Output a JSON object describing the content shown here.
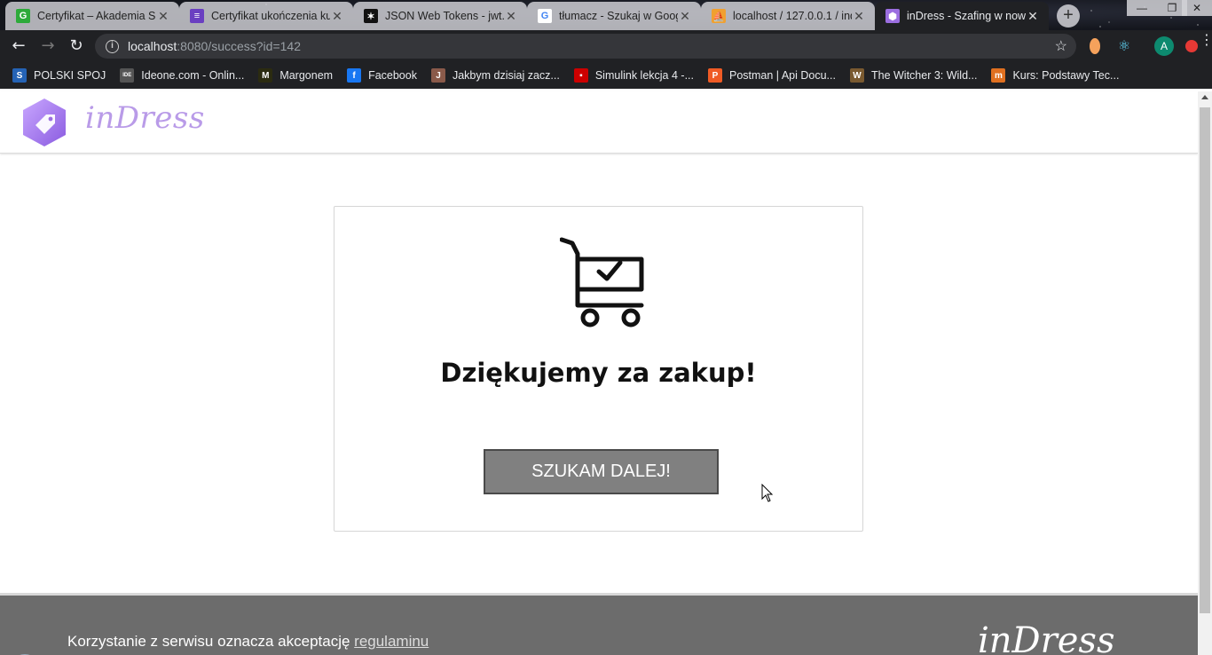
{
  "browser": {
    "tabs": [
      {
        "title": "Certyfikat – Akademia Sp",
        "fav_color": "#2eaa3a",
        "fav_glyph": "G",
        "active": false
      },
      {
        "title": "Certyfikat ukończenia ku",
        "fav_color": "#6a3fc1",
        "fav_glyph": "≡",
        "active": false
      },
      {
        "title": "JSON Web Tokens - jwt.",
        "fav_color": "#111111",
        "fav_glyph": "✶",
        "active": false
      },
      {
        "title": "tłumacz - Szukaj w Goog",
        "fav_color": "#ffffff",
        "fav_glyph": "G",
        "active": false
      },
      {
        "title": "localhost / 127.0.0.1 / ind",
        "fav_color": "#f0a030",
        "fav_glyph": "⛵",
        "active": false
      },
      {
        "title": "inDress - Szafing w now",
        "fav_color": "#9b6ee0",
        "fav_glyph": "⬢",
        "active": true
      }
    ],
    "newtab_glyph": "+",
    "url_host": "localhost",
    "url_rest": ":8080/success?id=142",
    "profile_initial": "A",
    "bookmarks": [
      {
        "label": "POLSKI SPOJ",
        "fav_color": "#2563b5",
        "fav_glyph": "S"
      },
      {
        "label": "Ideone.com - Onlin...",
        "fav_color": "#555555",
        "fav_glyph": "IDE"
      },
      {
        "label": "Margonem",
        "fav_color": "#2b2b10",
        "fav_glyph": "M"
      },
      {
        "label": "Facebook",
        "fav_color": "#1877f2",
        "fav_glyph": "f"
      },
      {
        "label": "Jakbym dzisiaj zacz...",
        "fav_color": "#8a5a4a",
        "fav_glyph": "J"
      },
      {
        "label": "Simulink lekcja 4 -...",
        "fav_color": "#cc0000",
        "fav_glyph": "▪"
      },
      {
        "label": "Postman | Api Docu...",
        "fav_color": "#ef5b25",
        "fav_glyph": "P"
      },
      {
        "label": "The Witcher 3: Wild...",
        "fav_color": "#7a5a30",
        "fav_glyph": "W"
      },
      {
        "label": "Kurs: Podstawy Tec...",
        "fav_color": "#e07020",
        "fav_glyph": "m"
      }
    ]
  },
  "site": {
    "logo_text": "inDress",
    "heading": "Dziękujemy za zakup!",
    "button_label": "SZUKAM DALEJ!",
    "footer_terms_prefix": "Korzystanie z serwisu oznacza akceptację ",
    "footer_terms_link": "regulaminu",
    "footer_logo": "inDress"
  },
  "colors": {
    "brand_purple": "#b99be8",
    "button_gray": "#808080",
    "footer_gray": "#6c6c6c"
  }
}
